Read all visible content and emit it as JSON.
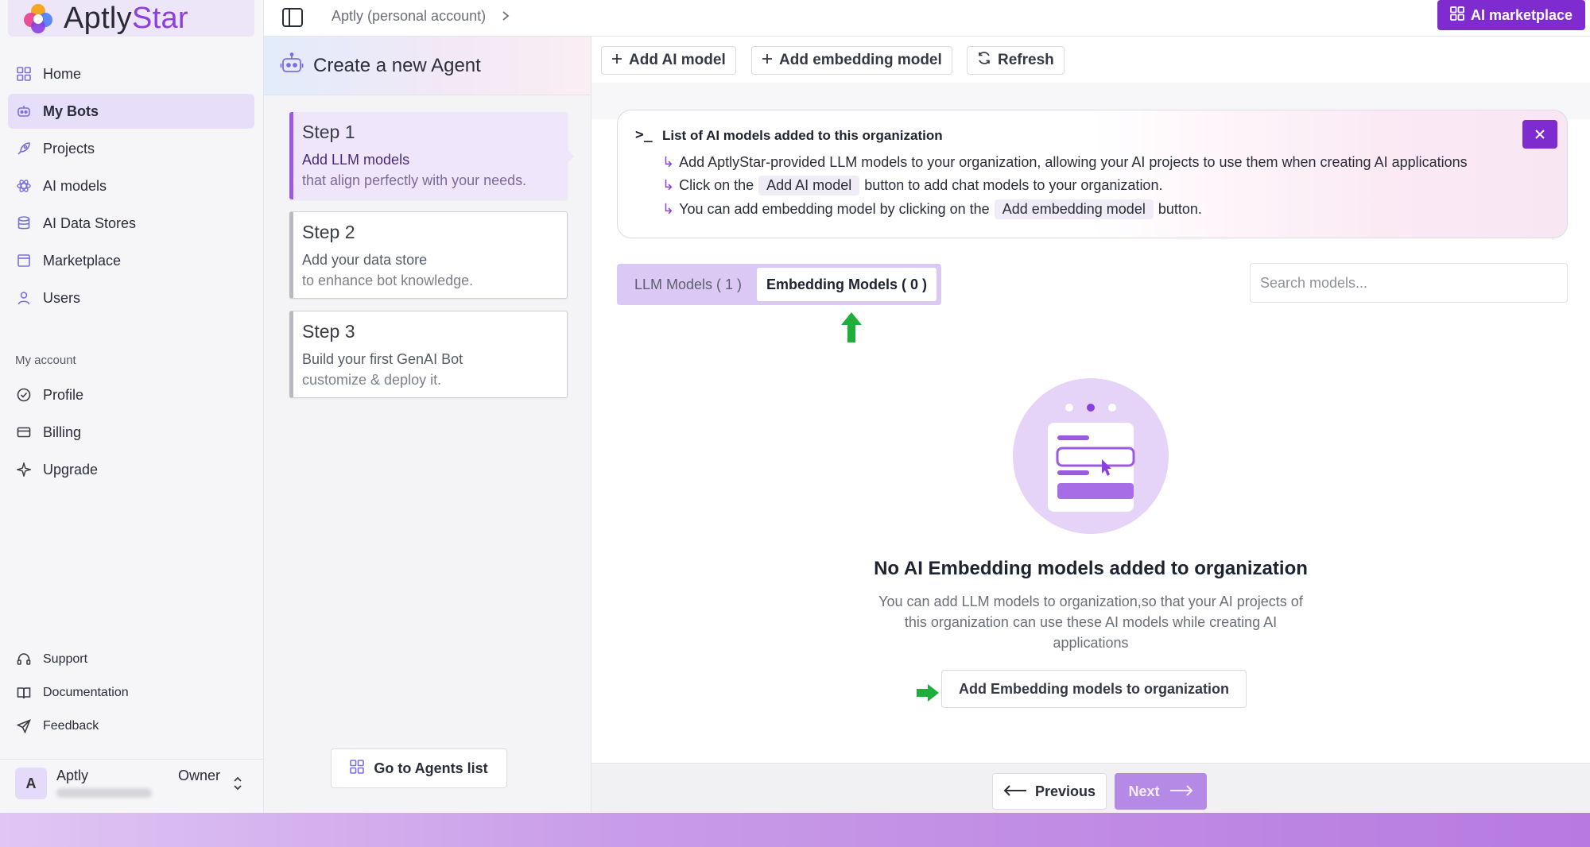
{
  "brand": {
    "name_prefix": "Aptly",
    "name_suffix": "Star"
  },
  "sidebar": {
    "items": [
      {
        "label": "Home",
        "icon": "grid-icon"
      },
      {
        "label": "My Bots",
        "icon": "bot-icon",
        "active": true
      },
      {
        "label": "Projects",
        "icon": "rocket-icon"
      },
      {
        "label": "AI models",
        "icon": "atom-icon"
      },
      {
        "label": "AI Data Stores",
        "icon": "database-icon"
      },
      {
        "label": "Marketplace",
        "icon": "store-icon"
      },
      {
        "label": "Users",
        "icon": "user-icon"
      }
    ],
    "account_section": "My account",
    "account_items": [
      {
        "label": "Profile",
        "icon": "profile-check-icon"
      },
      {
        "label": "Billing",
        "icon": "card-icon"
      },
      {
        "label": "Upgrade",
        "icon": "sparkle-icon"
      }
    ],
    "bottom_items": [
      {
        "label": "Support",
        "icon": "headset-icon"
      },
      {
        "label": "Documentation",
        "icon": "book-icon"
      },
      {
        "label": "Feedback",
        "icon": "send-icon"
      }
    ],
    "user": {
      "initial": "A",
      "name": "Aptly",
      "role": "Owner"
    }
  },
  "topbar": {
    "breadcrumb": "Aptly (personal account)",
    "marketplace_button": "AI marketplace"
  },
  "steps_panel": {
    "title": "Create a new Agent",
    "steps": [
      {
        "title": "Step 1",
        "line1": "Add LLM models",
        "line2": "that align perfectly with your needs.",
        "active": true
      },
      {
        "title": "Step 2",
        "line1": "Add your data store",
        "line2": "to enhance bot knowledge."
      },
      {
        "title": "Step 3",
        "line1": "Build your first GenAI Bot",
        "line2": "customize & deploy it."
      }
    ],
    "goto_button": "Go to Agents list"
  },
  "toolbar": {
    "add_ai_model": "Add AI model",
    "add_embedding_model": "Add embedding model",
    "refresh": "Refresh"
  },
  "info": {
    "prompt": ">_",
    "title": "List of AI models added to this organization",
    "line1": "Add AptlyStar-provided LLM models to your organization, allowing your AI projects to use them when creating AI applications",
    "line2_pre": "Click on the",
    "line2_chip": "Add AI model",
    "line2_post": "button to add chat models to your organization.",
    "line3_pre": "You can add embedding model by clicking on the",
    "line3_chip": "Add embedding model",
    "line3_post": "button."
  },
  "tabs": {
    "llm": "LLM Models ( 1 )",
    "embedding": "Embedding Models ( 0 )"
  },
  "search": {
    "placeholder": "Search models..."
  },
  "empty_state": {
    "title": "No AI Embedding models added to organization",
    "description": "You can add LLM models to organization,so that your AI projects of this organization can use these AI models while creating AI applications",
    "button": "Add Embedding models to organization"
  },
  "footer": {
    "previous": "Previous",
    "next": "Next"
  },
  "colors": {
    "accent": "#7e2bd0",
    "active_bg": "#e7def9",
    "green_arrow": "#1fae3c"
  }
}
